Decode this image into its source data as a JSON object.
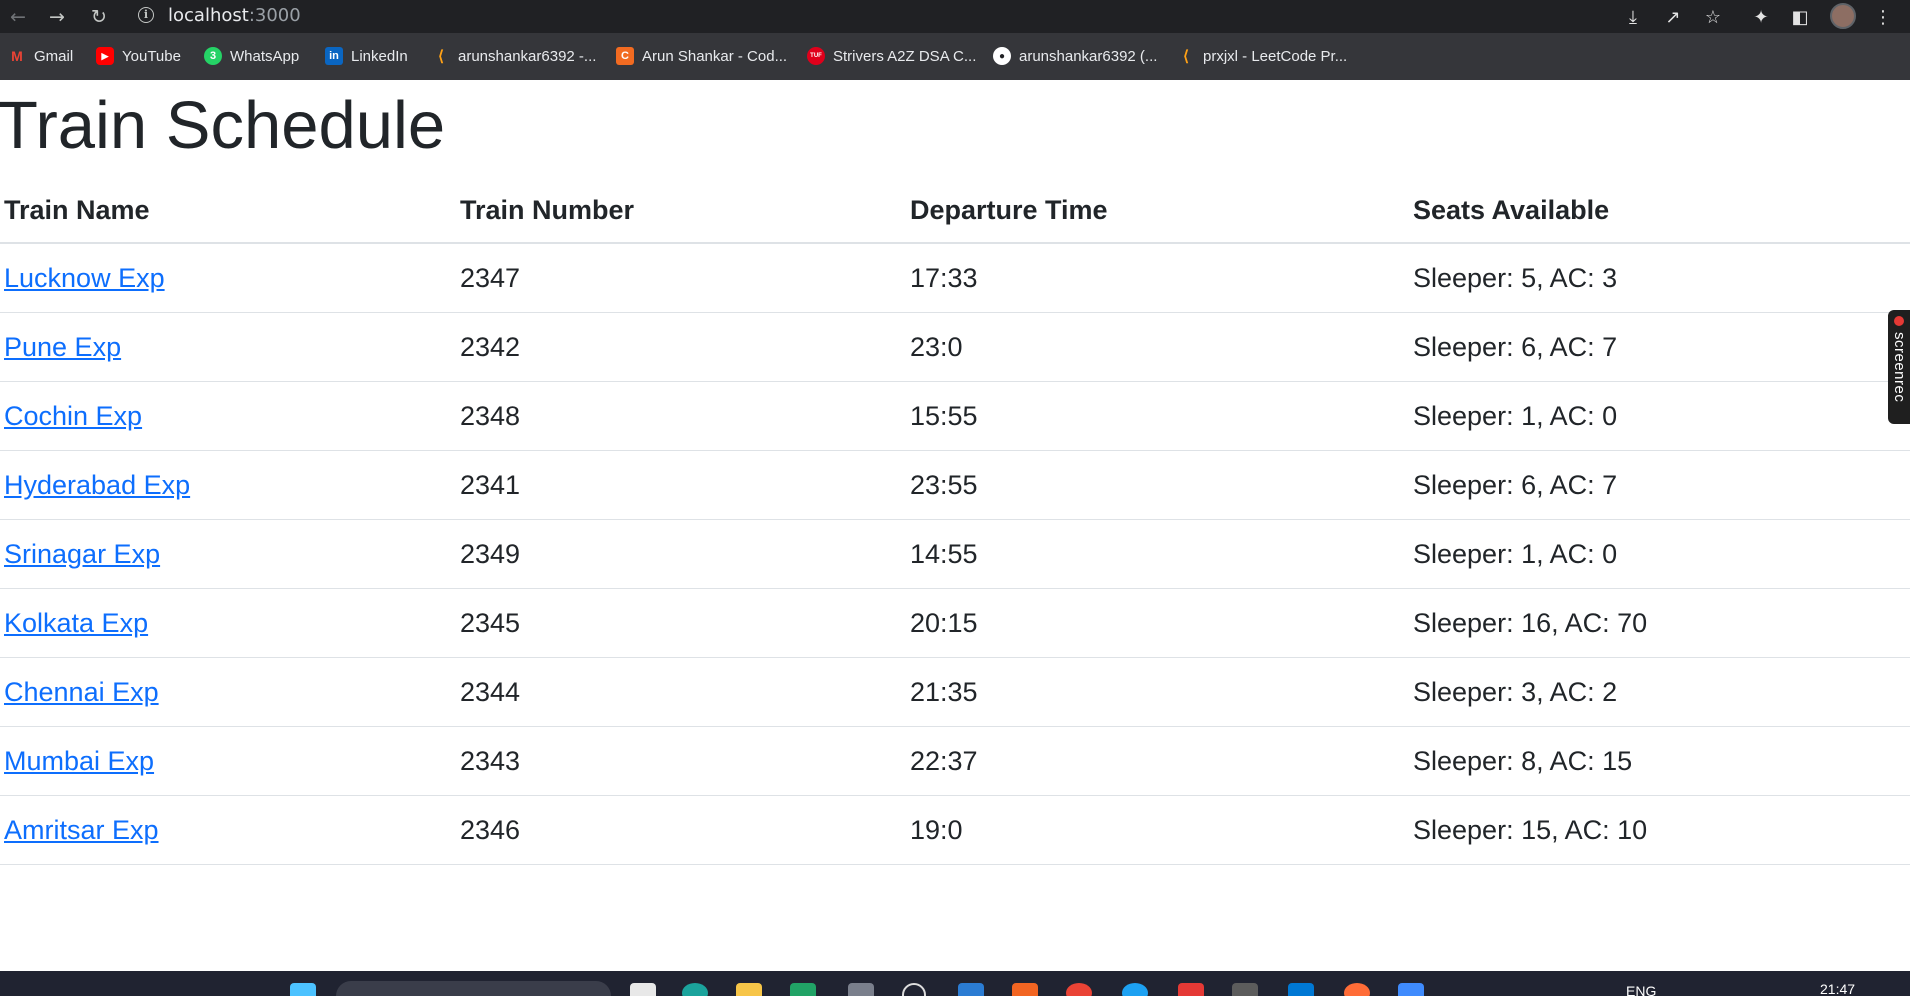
{
  "browser": {
    "url_host": "localhost",
    "url_port": ":3000",
    "bookmarks": [
      {
        "label": "Gmail",
        "icon": "gmail-icon",
        "color": "#ea4335"
      },
      {
        "label": "YouTube",
        "icon": "youtube-icon",
        "color": "#ff0000"
      },
      {
        "label": "WhatsApp",
        "icon": "whatsapp-icon",
        "color": "#25d366"
      },
      {
        "label": "LinkedIn",
        "icon": "linkedin-icon",
        "color": "#0a66c2"
      },
      {
        "label": "arunshankar6392 -...",
        "icon": "leetcode-icon",
        "color": "#ffa116"
      },
      {
        "label": "Arun Shankar - Cod...",
        "icon": "codingninjas-icon",
        "color": "#f26b21"
      },
      {
        "label": "Strivers A2Z DSA C...",
        "icon": "tuf-icon",
        "color": "#e0001b"
      },
      {
        "label": "arunshankar6392 (...",
        "icon": "github-icon",
        "color": "#ffffff"
      },
      {
        "label": "prxjxl - LeetCode Pr...",
        "icon": "leetcode-icon",
        "color": "#ffa116"
      }
    ]
  },
  "page": {
    "title": "Train Schedule",
    "link_color": "#0d6efd"
  },
  "table": {
    "headers": [
      "Train Name",
      "Train Number",
      "Departure Time",
      "Seats Available"
    ],
    "rows": [
      {
        "name": "Lucknow Exp",
        "number": "2347",
        "departure": "17:33",
        "seats": "Sleeper: 5, AC: 3"
      },
      {
        "name": "Pune Exp",
        "number": "2342",
        "departure": "23:0",
        "seats": "Sleeper: 6, AC: 7"
      },
      {
        "name": "Cochin Exp",
        "number": "2348",
        "departure": "15:55",
        "seats": "Sleeper: 1, AC: 0"
      },
      {
        "name": "Hyderabad Exp",
        "number": "2341",
        "departure": "23:55",
        "seats": "Sleeper: 6, AC: 7"
      },
      {
        "name": "Srinagar Exp",
        "number": "2349",
        "departure": "14:55",
        "seats": "Sleeper: 1, AC: 0"
      },
      {
        "name": "Kolkata Exp",
        "number": "2345",
        "departure": "20:15",
        "seats": "Sleeper: 16, AC: 70"
      },
      {
        "name": "Chennai Exp",
        "number": "2344",
        "departure": "21:35",
        "seats": "Sleeper: 3, AC: 2"
      },
      {
        "name": "Mumbai Exp",
        "number": "2343",
        "departure": "22:37",
        "seats": "Sleeper: 8, AC: 15"
      },
      {
        "name": "Amritsar Exp",
        "number": "2346",
        "departure": "19:0",
        "seats": "Sleeper: 15, AC: 10"
      }
    ]
  },
  "screenrec": {
    "label": "screenrec"
  },
  "taskbar": {
    "language": "ENG",
    "time": "21:47"
  }
}
